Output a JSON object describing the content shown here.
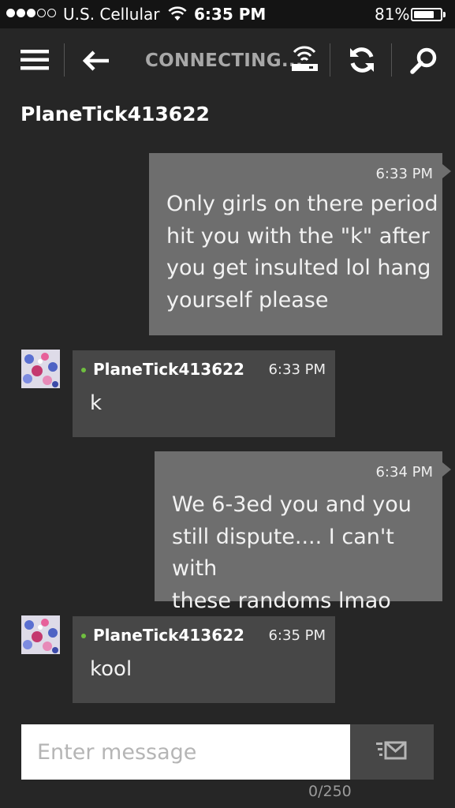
{
  "status_bar": {
    "carrier": "U.S. Cellular",
    "time": "6:35 PM",
    "battery": "81%",
    "battery_level": 0.81,
    "signal_bars_filled": 3,
    "signal_bars_total": 5
  },
  "app_bar": {
    "connection_status": "CONNECTING...",
    "icons": [
      "menu-icon",
      "back-arrow-icon",
      "network-wifi-icon",
      "refresh-icon",
      "search-icon"
    ]
  },
  "conversation": {
    "title": "PlaneTick413622"
  },
  "messages": [
    {
      "direction": "outgoing",
      "time": "6:33 PM",
      "lines": [
        "Only girls on there period",
        "hit you with the \"k\" after",
        "you get insulted lol hang",
        "yourself please"
      ]
    },
    {
      "direction": "incoming",
      "sender": "PlaneTick413622",
      "time": "6:33 PM",
      "text": "k"
    },
    {
      "direction": "outgoing",
      "time": "6:34 PM",
      "lines": [
        "We 6-3ed you and you",
        "still dispute.... I can't with",
        "these randoms lmao"
      ]
    },
    {
      "direction": "incoming",
      "sender": "PlaneTick413622",
      "time": "6:35 PM",
      "text": "kool"
    }
  ],
  "composer": {
    "placeholder": "Enter message",
    "char_count": "0/250"
  },
  "colors": {
    "background": "#262626",
    "outgoing_bubble": "#6e6e6e",
    "incoming_bubble": "#474747",
    "online_dot": "#6fbf3f",
    "status_bar": "#141414"
  }
}
